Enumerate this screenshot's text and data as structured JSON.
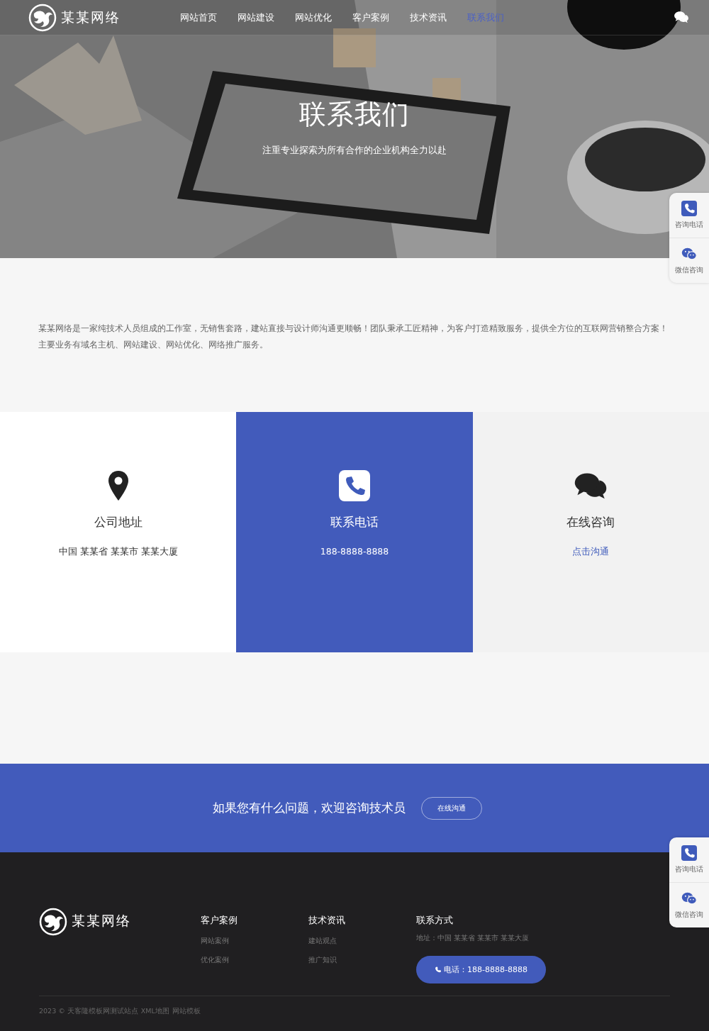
{
  "header": {
    "logo": {
      "name": "某某网络"
    },
    "nav": [
      {
        "label": "网站首页",
        "selected": false
      },
      {
        "label": "网站建设",
        "selected": false
      },
      {
        "label": "网站优化",
        "selected": false
      },
      {
        "label": "客户案例",
        "selected": false
      },
      {
        "label": "技术资讯",
        "selected": false
      },
      {
        "label": "联系我们",
        "selected": true
      }
    ]
  },
  "hero": {
    "kind": "picture",
    "title": "联系我们",
    "subtitle": "注重专业探索为所有合作的企业机构全力以赴"
  },
  "intro": "某某网络是一家纯技术人员组成的工作室，无销售套路，建站直接与设计师沟通更顺畅！团队秉承工匠精神，为客户打造精致服务，提供全方位的互联网营销整合方案！主要业务有域名主机、网站建设、网站优化、网络推广服务。",
  "cards": [
    {
      "kind": "address",
      "title": "公司地址",
      "text": "中国 某某省 某某市 某某大厦",
      "highlighted": false
    },
    {
      "kind": "phone",
      "title": "联系电话",
      "text": "188-8888-8888",
      "highlighted": true
    },
    {
      "kind": "chat",
      "title": "在线咨询",
      "text": "点击沟通",
      "link": true,
      "highlighted": false
    }
  ],
  "cta": {
    "text": "如果您有什么问题，欢迎咨询技术员",
    "button": "在线沟通"
  },
  "footer": {
    "logo": {
      "name": "某某网络"
    },
    "columns": [
      {
        "title": "客户案例",
        "links": [
          "网站案例",
          "优化案例"
        ]
      },
      {
        "title": "技术资讯",
        "links": [
          "建站观点",
          "推广知识"
        ]
      }
    ],
    "contact": {
      "title": "联系方式",
      "address": "地址：中国 某某省 某某市 某某大厦",
      "phone_button": "电话：188-8888-8888"
    },
    "copyright": "2023 © 天客隆模板网测试站点",
    "links": [
      "XML地图",
      "网站模板"
    ]
  },
  "side_widgets": [
    {
      "items": [
        {
          "kind": "phone",
          "label": "咨询电话"
        },
        {
          "kind": "wechat",
          "label": "微信咨询"
        }
      ]
    },
    {
      "items": [
        {
          "kind": "phone",
          "label": "咨询电话"
        },
        {
          "kind": "wechat",
          "label": "微信咨询"
        }
      ]
    }
  ]
}
